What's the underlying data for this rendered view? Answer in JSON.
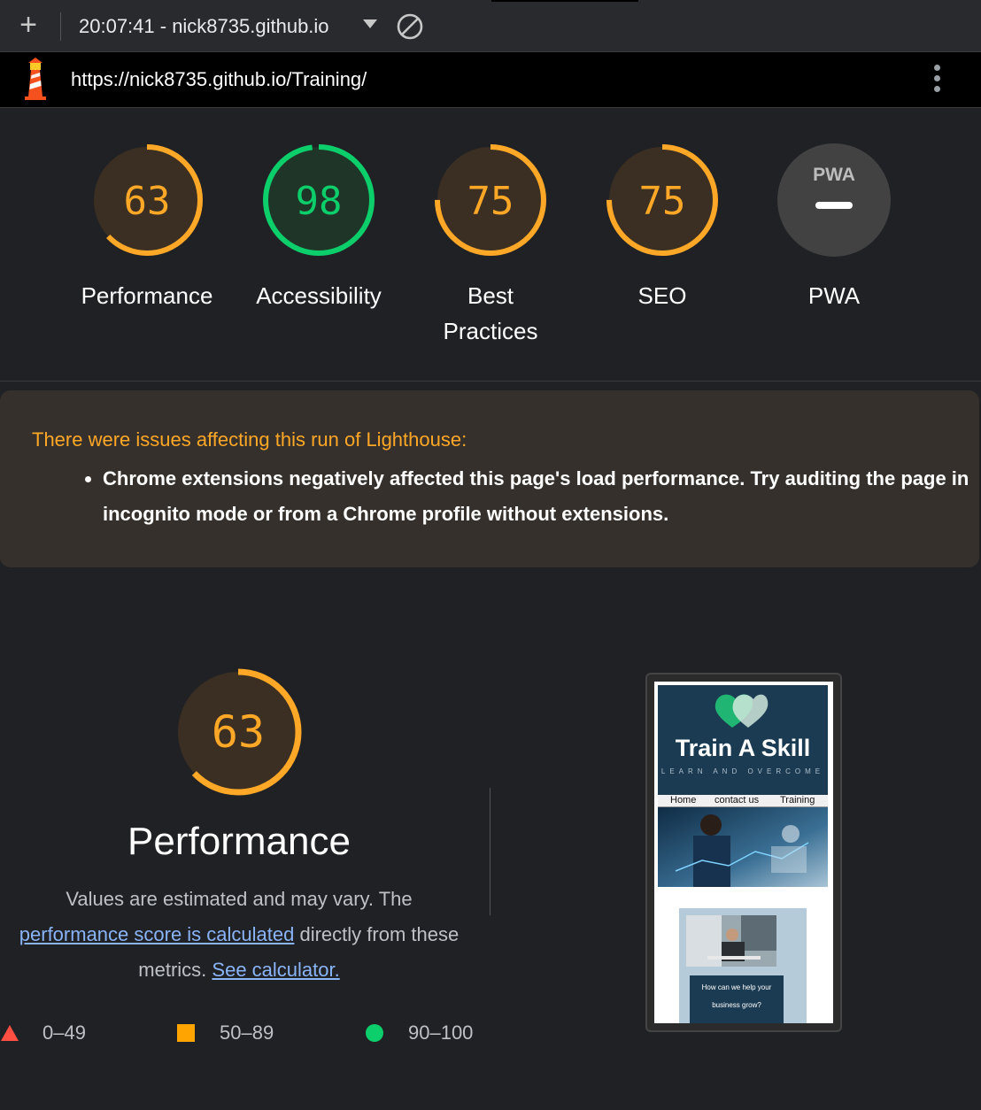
{
  "toolbar": {
    "add_icon": "plus-icon",
    "run_title": "20:07:41 - nick8735.github.io",
    "dropdown_icon": "caret-down-icon",
    "clear_icon": "block-icon"
  },
  "urlbar": {
    "logo_icon": "lighthouse-icon",
    "url": "https://nick8735.github.io/Training/",
    "menu_icon": "kebab-menu-icon"
  },
  "scores": [
    {
      "label": "Performance",
      "score": "63",
      "value": 63,
      "rating": "average"
    },
    {
      "label": "Accessibility",
      "score": "98",
      "value": 98,
      "rating": "pass"
    },
    {
      "label": "Best Practices",
      "score": "75",
      "value": 75,
      "rating": "average"
    },
    {
      "label": "SEO",
      "score": "75",
      "value": 75,
      "rating": "average"
    },
    {
      "label": "PWA",
      "badge": "PWA",
      "score": "",
      "rating": "na"
    }
  ],
  "warning": {
    "title": "There were issues affecting this run of Lighthouse:",
    "items": [
      "Chrome extensions negatively affected this page's load performance. Try auditing the page in incognito mode or from a Chrome profile without extensions."
    ]
  },
  "performance": {
    "score": "63",
    "value": 63,
    "title": "Performance",
    "desc_1": "Values are estimated and may vary. The",
    "link_score": "performance score is calculated",
    "desc_2": "directly from these metrics.",
    "link_calc": "See calculator."
  },
  "legend": [
    {
      "range": "0–49",
      "shape": "triangle",
      "color": "#ff4e42"
    },
    {
      "range": "50–89",
      "shape": "square",
      "color": "#ffa400"
    },
    {
      "range": "90–100",
      "shape": "circle",
      "color": "#0cce6b"
    }
  ],
  "screenshot": {
    "brand": "Train A Skill",
    "tagline": "LEARN AND OVERCOME",
    "nav": [
      "Home",
      "contact us",
      "Training"
    ],
    "cta": "How can we help your business grow?"
  },
  "colors": {
    "average": "#ffa726",
    "average_bg": "#3a2f22",
    "pass": "#0cce6b",
    "pass_bg": "#1e3527",
    "na": "#5f6368",
    "background": "#202124",
    "warning_bg": "#35302b",
    "link": "#8ab4f8"
  }
}
